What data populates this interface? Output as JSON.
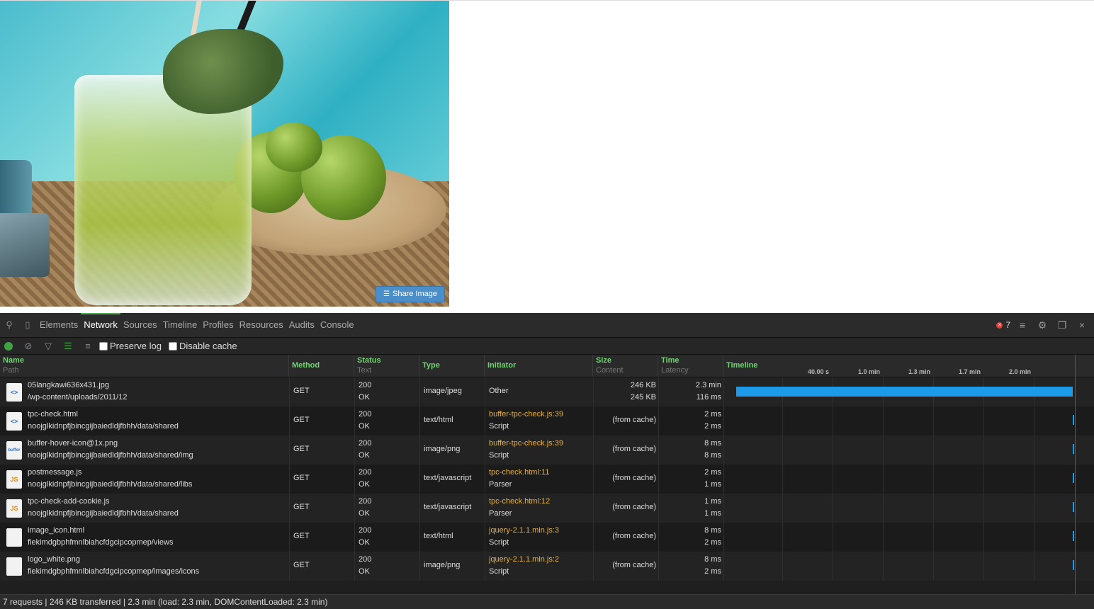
{
  "page": {
    "share_button": "Share Image",
    "share_icon": "layers-icon"
  },
  "devtools": {
    "tabs": [
      "Elements",
      "Network",
      "Sources",
      "Timeline",
      "Profiles",
      "Resources",
      "Audits",
      "Console"
    ],
    "active_tab": "Network",
    "error_count": "7",
    "toolbar": {
      "preserve_log": "Preserve log",
      "disable_cache": "Disable cache"
    },
    "columns": {
      "name": "Name",
      "path": "Path",
      "method": "Method",
      "status": "Status",
      "text": "Text",
      "type": "Type",
      "initiator": "Initiator",
      "size": "Size",
      "content": "Content",
      "time": "Time",
      "latency": "Latency",
      "timeline": "Timeline"
    },
    "timeline_ticks": [
      "40.00 s",
      "1.0 min",
      "1.3 min",
      "1.7 min",
      "2.0 min"
    ],
    "rows": [
      {
        "icon": "html",
        "icon_label": "<>",
        "name": "05langkawi636x431.jpg",
        "path": "/wp-content/uploads/2011/12",
        "method": "GET",
        "status": "200",
        "text": "OK",
        "type": "image/jpeg",
        "initiator": "Other",
        "initiator_type": "",
        "size": "246 KB",
        "content": "245 KB",
        "time": "2.3 min",
        "latency": "116 ms",
        "timeline_fraction": 1.0
      },
      {
        "icon": "html",
        "icon_label": "<>",
        "name": "tpc-check.html",
        "path": "noojglkidnpfjbincgijbaiedldjfbhh/data/shared",
        "method": "GET",
        "status": "200",
        "text": "OK",
        "type": "text/html",
        "initiator": "buffer-tpc-check.js:39",
        "initiator_type": "Script",
        "size": "(from cache)",
        "content": "",
        "time": "2 ms",
        "latency": "2 ms",
        "timeline_fraction": 0.0
      },
      {
        "icon": "img",
        "icon_label": "buffer",
        "name": "buffer-hover-icon@1x.png",
        "path": "noojglkidnpfjbincgijbaiedldjfbhh/data/shared/img",
        "method": "GET",
        "status": "200",
        "text": "OK",
        "type": "image/png",
        "initiator": "buffer-tpc-check.js:39",
        "initiator_type": "Script",
        "size": "(from cache)",
        "content": "",
        "time": "8 ms",
        "latency": "8 ms",
        "timeline_fraction": 0.0
      },
      {
        "icon": "js",
        "icon_label": "JS",
        "name": "postmessage.js",
        "path": "noojglkidnpfjbincgijbaiedldjfbhh/data/shared/libs",
        "method": "GET",
        "status": "200",
        "text": "OK",
        "type": "text/javascript",
        "initiator": "tpc-check.html:11",
        "initiator_type": "Parser",
        "size": "(from cache)",
        "content": "",
        "time": "2 ms",
        "latency": "1 ms",
        "timeline_fraction": 0.0
      },
      {
        "icon": "js",
        "icon_label": "JS",
        "name": "tpc-check-add-cookie.js",
        "path": "noojglkidnpfjbincgijbaiedldjfbhh/data/shared",
        "method": "GET",
        "status": "200",
        "text": "OK",
        "type": "text/javascript",
        "initiator": "tpc-check.html:12",
        "initiator_type": "Parser",
        "size": "(from cache)",
        "content": "",
        "time": "1 ms",
        "latency": "1 ms",
        "timeline_fraction": 0.0
      },
      {
        "icon": "blank",
        "icon_label": "",
        "name": "image_icon.html",
        "path": "fiekimdgbphfmnlbiahcfdgcipcopmep/views",
        "method": "GET",
        "status": "200",
        "text": "OK",
        "type": "text/html",
        "initiator": "jquery-2.1.1.min.js:3",
        "initiator_type": "Script",
        "size": "(from cache)",
        "content": "",
        "time": "8 ms",
        "latency": "2 ms",
        "timeline_fraction": 0.0
      },
      {
        "icon": "blank",
        "icon_label": "",
        "name": "logo_white.png",
        "path": "fiekimdgbphfmnlbiahcfdgcipcopmep/images/icons",
        "method": "GET",
        "status": "200",
        "text": "OK",
        "type": "image/png",
        "initiator": "jquery-2.1.1.min.js:2",
        "initiator_type": "Script",
        "size": "(from cache)",
        "content": "",
        "time": "8 ms",
        "latency": "2 ms",
        "timeline_fraction": 0.0
      }
    ],
    "status_bar": "7 requests | 246 KB transferred | 2.3 min (load: 2.3 min, DOMContentLoaded: 2.3 min)"
  }
}
